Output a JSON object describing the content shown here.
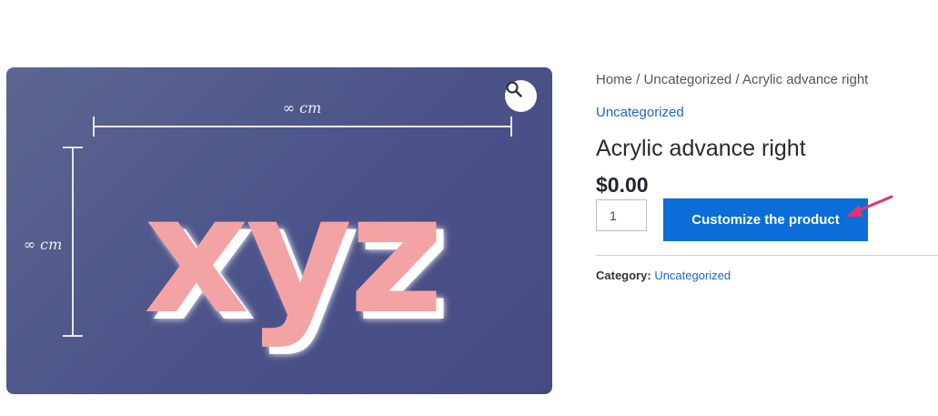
{
  "gallery": {
    "image_text": "xyz",
    "width_dim_label": "∞ cm",
    "height_dim_label": "∞ cm",
    "zoom_icon": "magnifier-icon"
  },
  "breadcrumb": {
    "home": "Home",
    "sep1": " / ",
    "category": "Uncategorized",
    "sep2": " / ",
    "current": "Acrylic advance right"
  },
  "product": {
    "category_link": "Uncategorized",
    "title": "Acrylic advance right",
    "price": "$0.00",
    "quantity": "1",
    "cta_label": "Customize the product",
    "meta_label": "Category:",
    "meta_value": "Uncategorized"
  },
  "colors": {
    "accent": "#0a6dd8",
    "link": "#1e66c8",
    "annotation_arrow": "#e8326d",
    "image_text_fill": "#f4a3a5"
  }
}
